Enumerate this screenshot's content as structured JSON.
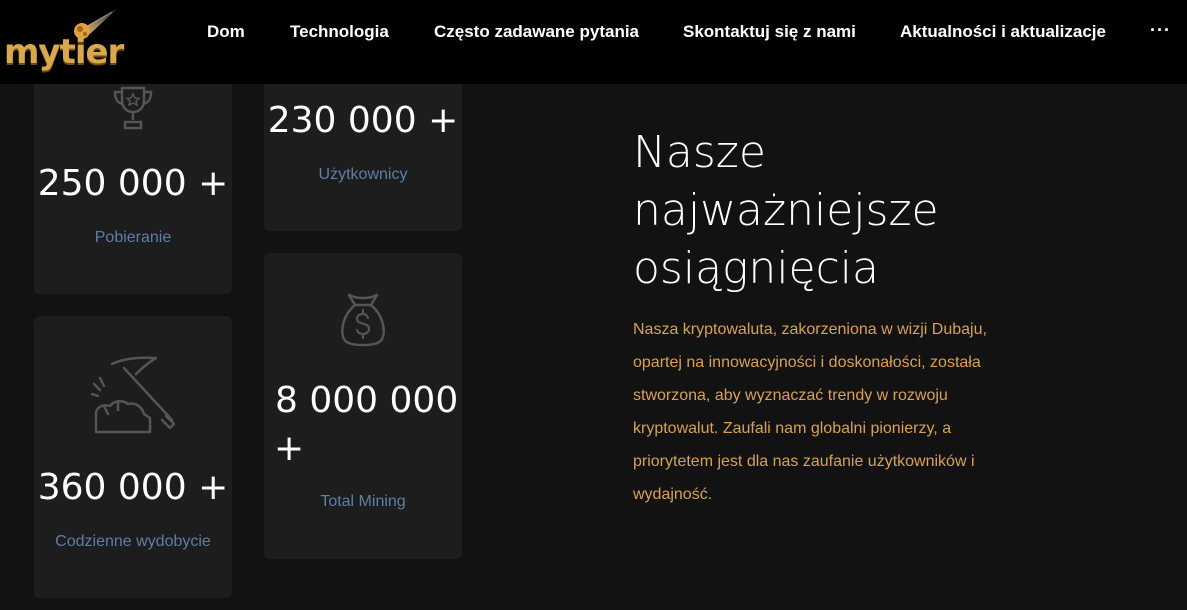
{
  "header": {
    "logo_text": "mytier",
    "nav": [
      "Dom",
      "Technologia",
      "Często zadawane pytania",
      "Skontaktuj się z nami",
      "Aktualności i aktualizacje"
    ],
    "more": "···"
  },
  "stats": [
    {
      "value": "250 000 +",
      "label": "Pobieranie",
      "icon": "trophy-icon"
    },
    {
      "value": "230 000 +",
      "label": "Użytkownicy",
      "icon": ""
    },
    {
      "value": "360 000 +",
      "label": "Codzienne wydobycie",
      "icon": "pickaxe-icon"
    },
    {
      "value_line1": "8 000 000",
      "value_line2": "+",
      "label": "Total Mining",
      "icon": "money-bag-icon"
    }
  ],
  "content": {
    "title_lines": [
      "Nasze",
      "najważniejsze",
      "osiągnięcia"
    ],
    "description": "Nasza kryptowaluta, zakorzeniona w wizji Dubaju, opartej na innowacyjności i doskonałości, została stworzona, aby wyznaczać trendy w rozwoju kryptowalut. Zaufali nam globalni pionierzy, a priorytetem jest dla nas zaufanie użytkowników i wydajność."
  },
  "colors": {
    "background": "#121212",
    "card": "#1d1d1d",
    "label": "#5d7fa6",
    "accent": "#d8a156",
    "logo": "#d9a84e"
  }
}
